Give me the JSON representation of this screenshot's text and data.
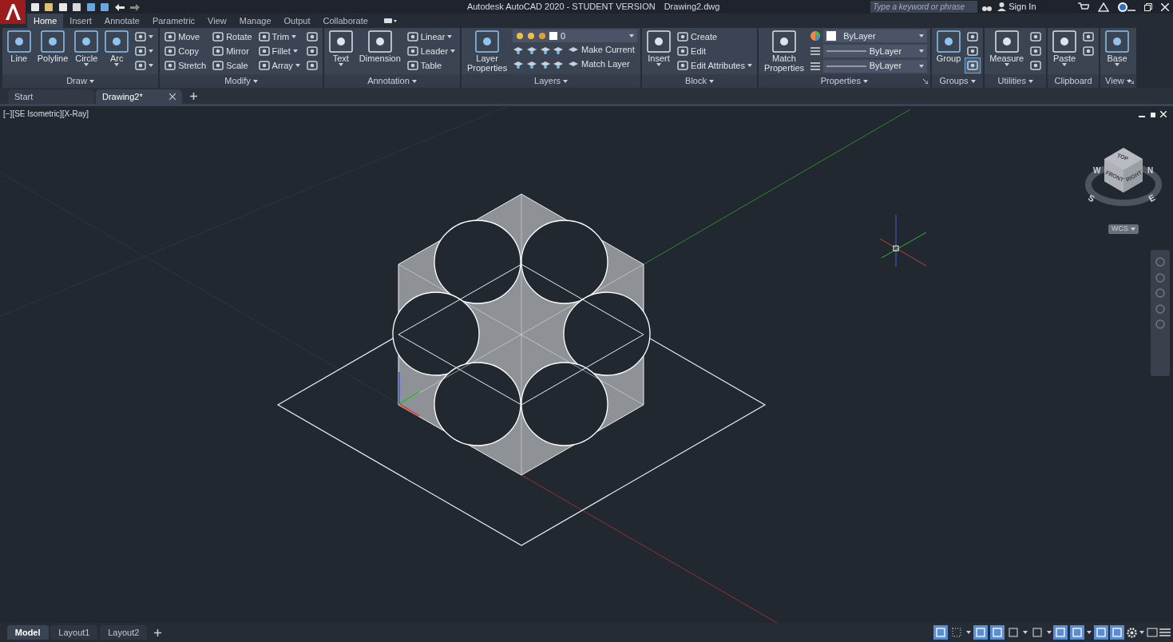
{
  "title_bar": {
    "app_title": "Autodesk AutoCAD 2020 - STUDENT VERSION",
    "file_name": "Drawing2.dwg",
    "search": {
      "placeholder": "Type a keyword or phrase"
    },
    "sign_in": "Sign In"
  },
  "ribbon_tabs": [
    {
      "label": "Home",
      "selected": true
    },
    {
      "label": "Insert",
      "selected": false
    },
    {
      "label": "Annotate",
      "selected": false
    },
    {
      "label": "Parametric",
      "selected": false
    },
    {
      "label": "View",
      "selected": false
    },
    {
      "label": "Manage",
      "selected": false
    },
    {
      "label": "Output",
      "selected": false
    },
    {
      "label": "Collaborate",
      "selected": false
    }
  ],
  "panels": [
    {
      "title": "Draw",
      "caret": true,
      "columns": [
        {
          "kind": "large",
          "label": "Line",
          "caret": false
        },
        {
          "kind": "large",
          "label": "Polyline",
          "caret": false
        },
        {
          "kind": "large",
          "label": "Circle",
          "caret": true
        },
        {
          "kind": "large",
          "label": "Arc",
          "caret": true
        },
        {
          "kind": "stack",
          "rows": [
            {
              "caret": true
            },
            {
              "caret": true
            },
            {
              "caret": true
            }
          ]
        }
      ]
    },
    {
      "title": "Modify",
      "caret": true,
      "columns": [
        {
          "kind": "stack",
          "rows": [
            {
              "label": "Move",
              "caret": false
            },
            {
              "label": "Copy",
              "caret": false
            },
            {
              "label": "Stretch",
              "caret": false
            }
          ]
        },
        {
          "kind": "stack",
          "rows": [
            {
              "label": "Rotate",
              "caret": false
            },
            {
              "label": "Mirror",
              "caret": false
            },
            {
              "label": "Scale",
              "caret": false
            }
          ]
        },
        {
          "kind": "stack",
          "rows": [
            {
              "label": "Trim",
              "caret": true
            },
            {
              "label": "Fillet",
              "caret": true
            },
            {
              "label": "Array",
              "caret": true
            }
          ]
        },
        {
          "kind": "stack",
          "rows": [
            {
              "caret": false
            },
            {
              "caret": false
            },
            {
              "caret": false
            }
          ]
        }
      ]
    },
    {
      "title": "Annotation",
      "caret": true,
      "columns": [
        {
          "kind": "large",
          "label": "Text",
          "caret": true
        },
        {
          "kind": "large",
          "label": "Dimension",
          "caret": false
        },
        {
          "kind": "stack",
          "rows": [
            {
              "label": "Linear",
              "caret": true
            },
            {
              "label": "Leader",
              "caret": true
            },
            {
              "label": "Table",
              "caret": false
            }
          ]
        }
      ]
    },
    {
      "title": "Layers",
      "caret": true,
      "columns": [
        {
          "kind": "large",
          "label": "Layer Properties",
          "caret": false
        },
        {
          "kind": "layer_tools",
          "value": "0",
          "rows": [
            {
              "label": "Make Current"
            },
            {
              "label": "Match Layer"
            }
          ]
        }
      ]
    },
    {
      "title": "Block",
      "caret": true,
      "columns": [
        {
          "kind": "large",
          "label": "Insert",
          "caret": true
        },
        {
          "kind": "stack",
          "rows": [
            {
              "label": "Create",
              "caret": false
            },
            {
              "label": "Edit",
              "caret": false
            },
            {
              "label": "Edit Attributes",
              "caret": true
            }
          ]
        }
      ]
    },
    {
      "title": "Properties",
      "caret": true,
      "launcher": true,
      "columns": [
        {
          "kind": "large",
          "label": "Match Properties",
          "caret": false
        },
        {
          "kind": "combos",
          "rows": [
            {
              "kind": "color",
              "value": "ByLayer"
            },
            {
              "kind": "line",
              "value": "ByLayer"
            },
            {
              "kind": "line",
              "value": "ByLayer"
            }
          ]
        }
      ]
    },
    {
      "title": "Groups",
      "caret": true,
      "columns": [
        {
          "kind": "large",
          "label": "Group",
          "caret": false
        },
        {
          "kind": "stack",
          "rows": [
            {
              "caret": false
            },
            {
              "caret": false
            },
            {
              "caret": false,
              "selected": true
            }
          ]
        }
      ]
    },
    {
      "title": "Utilities",
      "caret": true,
      "columns": [
        {
          "kind": "large",
          "label": "Measure",
          "caret": true
        },
        {
          "kind": "stack",
          "rows": [
            {
              "caret": false
            },
            {
              "caret": false
            },
            {
              "caret": false
            }
          ]
        }
      ]
    },
    {
      "title": "Clipboard",
      "caret": false,
      "columns": [
        {
          "kind": "large",
          "label": "Paste",
          "caret": true
        },
        {
          "kind": "stack",
          "rows": [
            {
              "caret": false
            },
            {
              "caret": false
            }
          ]
        }
      ]
    },
    {
      "title": "View",
      "caret": true,
      "launcher": true,
      "columns": [
        {
          "kind": "large",
          "label": "Base",
          "caret": true
        }
      ]
    }
  ],
  "file_tabs": [
    {
      "label": "Start",
      "selected": false,
      "closable": false
    },
    {
      "label": "Drawing2*",
      "selected": true,
      "closable": true
    }
  ],
  "viewport": {
    "label": "[−][SE Isometric][X-Ray]",
    "viewcube": {
      "top": "TOP",
      "front": "FRONT",
      "right": "RIGHT",
      "north": "N",
      "east": "E",
      "south": "S",
      "west": "W",
      "ucs": "WCS"
    }
  },
  "layout_tabs": [
    {
      "label": "Model",
      "selected": true
    },
    {
      "label": "Layout1",
      "selected": false
    },
    {
      "label": "Layout2",
      "selected": false
    }
  ],
  "status_toggles": [
    {
      "on": true
    },
    {
      "on": false
    },
    {
      "on": true
    },
    {
      "on": true
    },
    {
      "on": false
    },
    {
      "on": false
    },
    {
      "on": true
    },
    {
      "on": true
    },
    {
      "on": true
    },
    {
      "on": true
    }
  ]
}
